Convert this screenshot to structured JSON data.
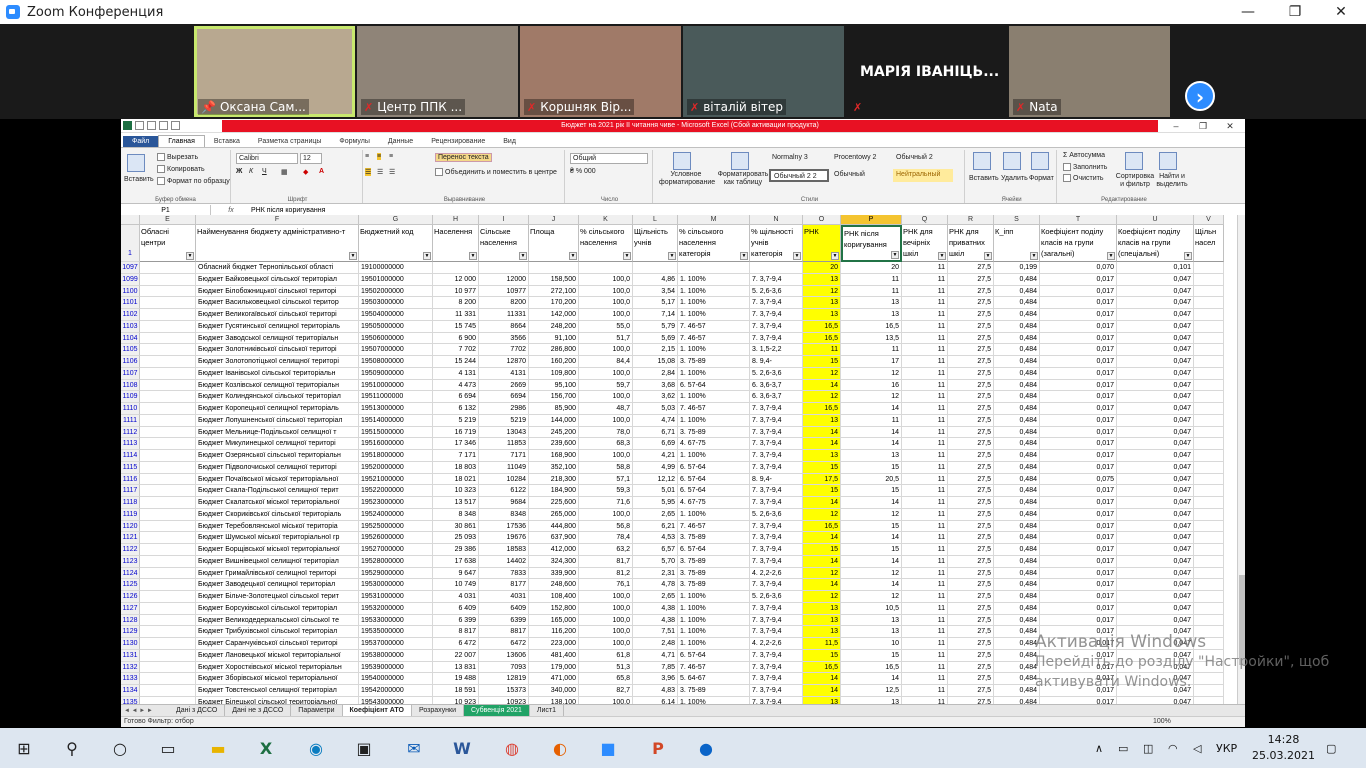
{
  "zoom": {
    "title": "Zoom Конференция",
    "participants": [
      {
        "name": "Оксана Сам...",
        "muted": false,
        "pinned": true,
        "speaking": true,
        "bg": "#b8a890"
      },
      {
        "name": "Центр ППК ...",
        "muted": true,
        "bg": "#8f8478"
      },
      {
        "name": "Коршняк Вір...",
        "muted": true,
        "bg": "#a07a68"
      },
      {
        "name": "віталій вітер",
        "muted": true,
        "bg": "#4a5a5a"
      },
      {
        "name": "МАРІЯ ІВАНІЦЬ...",
        "muted": true,
        "bg": "#1a1a1a",
        "name_only": true
      },
      {
        "name": "Nata",
        "muted": true,
        "bg": "#8a7f70"
      }
    ],
    "next_icon": "chevron-right-icon"
  },
  "excel": {
    "title": "Бюджет на 2021 рік II читання чиве - Microsoft Excel (Сбой активации продукта)",
    "tabs": [
      "Файл",
      "Главная",
      "Вставка",
      "Разметка страницы",
      "Формулы",
      "Данные",
      "Рецензирование",
      "Вид"
    ],
    "ribbon": {
      "clipboard": {
        "paste": "Вставить",
        "cut": "Вырезать",
        "copy": "Копировать",
        "format": "Формат по образцу",
        "label": "Буфер обмена"
      },
      "font": {
        "name": "Calibri",
        "size": "12",
        "label": "Шрифт"
      },
      "align": {
        "wrap": "Перенос текста",
        "merge": "Объединить и поместить в центре",
        "label": "Выравнивание"
      },
      "number": {
        "format": "Общий",
        "label": "Число"
      },
      "styles": {
        "cond": "Условное форматирование",
        "table": "Форматировать как таблицу",
        "s1": "Normalny 3",
        "s2": "Procentowy 2",
        "s3": "Обычный 2",
        "s4": "Обычный 2 2",
        "s5": "Обычный",
        "s6": "Нейтральный",
        "label": "Стили"
      },
      "cells": {
        "insert": "Вставить",
        "delete": "Удалить",
        "format": "Формат",
        "label": "Ячейки"
      },
      "edit": {
        "autosum": "Автосумма",
        "fill": "Заполнить",
        "clear": "Очистить",
        "sort": "Сортировка и фильтр",
        "find": "Найти и выделить",
        "label": "Редактирование"
      }
    },
    "namebox": "P1",
    "formula": "РНК після коригування",
    "columns": [
      "E",
      "F",
      "G",
      "H",
      "I",
      "J",
      "K",
      "L",
      "M",
      "N",
      "O",
      "P",
      "Q",
      "R",
      "S",
      "T",
      "U",
      "V"
    ],
    "selected_col": "P",
    "headers": [
      "Обласні центри",
      "Найменування бюджету адміністративно-т",
      "Бюджетний код",
      "Населення",
      "Сільське населення",
      "Площа",
      "% сільського населення",
      "Щільність учнів",
      "% сільського населення категорія",
      "% щільності учнів категорія",
      "РНК",
      "РНК після коригування",
      "РНК для вечірніх шкіл",
      "РНК для приватних шкіл",
      "К_іпп",
      "Коефіцієнт поділу класів на групи (загальні)",
      "Коефіцієнт поділу класів на групи (спеціальні)",
      "Щільн насел"
    ],
    "header_row": "1",
    "rows": [
      [
        "1097",
        "",
        "Обласний бюджет Тернопільської області",
        "19100000000",
        "",
        "",
        "",
        "",
        "",
        "",
        "",
        "20",
        "20",
        "11",
        "27,5",
        "0,199",
        "0,070",
        "0,101"
      ],
      [
        "1099",
        "",
        "Бюджет Байковецької сільської територіал",
        "19501000000",
        "12 000",
        "12000",
        "158,500",
        "100,0",
        "4,86",
        "1. 100%",
        "7. 3,7-9,4",
        "13",
        "11",
        "11",
        "27,5",
        "0,484",
        "0,017",
        "0,047"
      ],
      [
        "1100",
        "",
        "Бюджет Білобожницької сільської територі",
        "19502000000",
        "10 977",
        "10977",
        "272,100",
        "100,0",
        "3,54",
        "1. 100%",
        "5. 2,6-3,6",
        "12",
        "11",
        "11",
        "27,5",
        "0,484",
        "0,017",
        "0,047"
      ],
      [
        "1101",
        "",
        "Бюджет Васильковецької сільської територ",
        "19503000000",
        "8 200",
        "8200",
        "170,200",
        "100,0",
        "5,17",
        "1. 100%",
        "7. 3,7-9,4",
        "13",
        "13",
        "11",
        "27,5",
        "0,484",
        "0,017",
        "0,047"
      ],
      [
        "1102",
        "",
        "Бюджет Великогаївської сільської територі",
        "19504000000",
        "11 331",
        "11331",
        "142,000",
        "100,0",
        "7,14",
        "1. 100%",
        "7. 3,7-9,4",
        "13",
        "13",
        "11",
        "27,5",
        "0,484",
        "0,017",
        "0,047"
      ],
      [
        "1103",
        "",
        "Бюджет Гусятинської селищної територіаль",
        "19505000000",
        "15 745",
        "8664",
        "248,200",
        "55,0",
        "5,79",
        "7. 46-57",
        "7. 3,7-9,4",
        "16,5",
        "16,5",
        "11",
        "27,5",
        "0,484",
        "0,017",
        "0,047"
      ],
      [
        "1104",
        "",
        "Бюджет Заводської селищної територіальн",
        "19506000000",
        "6 900",
        "3566",
        "91,100",
        "51,7",
        "5,69",
        "7. 46-57",
        "7. 3,7-9,4",
        "16,5",
        "13,5",
        "11",
        "27,5",
        "0,484",
        "0,017",
        "0,047"
      ],
      [
        "1105",
        "",
        "Бюджет Золотниківської сільської територі",
        "19507000000",
        "7 702",
        "7702",
        "286,800",
        "100,0",
        "2,15",
        "1. 100%",
        "3. 1,5-2,2",
        "11",
        "11",
        "11",
        "27,5",
        "0,484",
        "0,017",
        "0,047"
      ],
      [
        "1106",
        "",
        "Бюджет Золотопотіцької селищної територі",
        "19508000000",
        "15 244",
        "12870",
        "160,200",
        "84,4",
        "15,08",
        "3. 75-89",
        "8. 9,4-",
        "15",
        "17",
        "11",
        "27,5",
        "0,484",
        "0,017",
        "0,047"
      ],
      [
        "1107",
        "",
        "Бюджет Іванівської сільської територіальн",
        "19509000000",
        "4 131",
        "4131",
        "109,800",
        "100,0",
        "2,84",
        "1. 100%",
        "5. 2,6-3,6",
        "12",
        "12",
        "11",
        "27,5",
        "0,484",
        "0,017",
        "0,047"
      ],
      [
        "1108",
        "",
        "Бюджет Козлівської селищної територіальн",
        "19510000000",
        "4 473",
        "2669",
        "95,100",
        "59,7",
        "3,68",
        "6. 57-64",
        "6. 3,6-3,7",
        "14",
        "16",
        "11",
        "27,5",
        "0,484",
        "0,017",
        "0,047"
      ],
      [
        "1109",
        "",
        "Бюджет Колиндянської сільської територіал",
        "19511000000",
        "6 694",
        "6694",
        "156,700",
        "100,0",
        "3,62",
        "1. 100%",
        "6. 3,6-3,7",
        "12",
        "12",
        "11",
        "27,5",
        "0,484",
        "0,017",
        "0,047"
      ],
      [
        "1110",
        "",
        "Бюджет Коропецької селищної територіаль",
        "19513000000",
        "6 132",
        "2986",
        "85,900",
        "48,7",
        "5,03",
        "7. 46-57",
        "7. 3,7-9,4",
        "16,5",
        "14",
        "11",
        "27,5",
        "0,484",
        "0,017",
        "0,047"
      ],
      [
        "1111",
        "",
        "Бюджет Лопушненської сільської територіал",
        "19514000000",
        "5 219",
        "5219",
        "144,000",
        "100,0",
        "4,74",
        "1. 100%",
        "7. 3,7-9,4",
        "13",
        "11",
        "11",
        "27,5",
        "0,484",
        "0,017",
        "0,047"
      ],
      [
        "1112",
        "",
        "Бюджет Мельнице-Подільської селищної т",
        "19515000000",
        "16 719",
        "13043",
        "245,200",
        "78,0",
        "6,71",
        "3. 75-89",
        "7. 3,7-9,4",
        "14",
        "14",
        "11",
        "27,5",
        "0,484",
        "0,017",
        "0,047"
      ],
      [
        "1113",
        "",
        "Бюджет Микулинецької селищної територі",
        "19516000000",
        "17 346",
        "11853",
        "239,600",
        "68,3",
        "6,69",
        "4. 67-75",
        "7. 3,7-9,4",
        "14",
        "14",
        "11",
        "27,5",
        "0,484",
        "0,017",
        "0,047"
      ],
      [
        "1114",
        "",
        "Бюджет Озерянської сільської територіальн",
        "19518000000",
        "7 171",
        "7171",
        "168,900",
        "100,0",
        "4,21",
        "1. 100%",
        "7. 3,7-9,4",
        "13",
        "13",
        "11",
        "27,5",
        "0,484",
        "0,017",
        "0,047"
      ],
      [
        "1115",
        "",
        "Бюджет Підволочиської селищної територі",
        "19520000000",
        "18 803",
        "11049",
        "352,100",
        "58,8",
        "4,99",
        "6. 57-64",
        "7. 3,7-9,4",
        "15",
        "15",
        "11",
        "27,5",
        "0,484",
        "0,017",
        "0,047"
      ],
      [
        "1116",
        "",
        "Бюджет Почаївської міської територіальної",
        "19521000000",
        "18 021",
        "10284",
        "218,300",
        "57,1",
        "12,12",
        "6. 57-64",
        "8. 9,4-",
        "17,5",
        "20,5",
        "11",
        "27,5",
        "0,484",
        "0,075",
        "0,047"
      ],
      [
        "1117",
        "",
        "Бюджет Скала-Подільської селищної терит",
        "19522000000",
        "10 323",
        "6122",
        "184,900",
        "59,3",
        "5,01",
        "6. 57-64",
        "7. 3,7-9,4",
        "15",
        "15",
        "11",
        "27,5",
        "0,484",
        "0,017",
        "0,047"
      ],
      [
        "1118",
        "",
        "Бюджет Скалатської міської територіальної",
        "19523000000",
        "13 517",
        "9684",
        "225,600",
        "71,6",
        "5,95",
        "4. 67-75",
        "7. 3,7-9,4",
        "14",
        "14",
        "11",
        "27,5",
        "0,484",
        "0,017",
        "0,047"
      ],
      [
        "1119",
        "",
        "Бюджет Скориківської сільської територіаль",
        "19524000000",
        "8 348",
        "8348",
        "265,000",
        "100,0",
        "2,65",
        "1. 100%",
        "5. 2,6-3,6",
        "12",
        "12",
        "11",
        "27,5",
        "0,484",
        "0,017",
        "0,047"
      ],
      [
        "1120",
        "",
        "Бюджет Теребовлянської міської територіа",
        "19525000000",
        "30 861",
        "17536",
        "444,800",
        "56,8",
        "6,21",
        "7. 46-57",
        "7. 3,7-9,4",
        "16,5",
        "15",
        "11",
        "27,5",
        "0,484",
        "0,017",
        "0,047"
      ],
      [
        "1121",
        "",
        "Бюджет Шумської міської територіальної гр",
        "19526000000",
        "25 093",
        "19676",
        "637,900",
        "78,4",
        "4,53",
        "3. 75-89",
        "7. 3,7-9,4",
        "14",
        "14",
        "11",
        "27,5",
        "0,484",
        "0,017",
        "0,047"
      ],
      [
        "1122",
        "",
        "Бюджет Борщівської міської територіальної",
        "19527000000",
        "29 386",
        "18583",
        "412,000",
        "63,2",
        "6,57",
        "6. 57-64",
        "7. 3,7-9,4",
        "15",
        "15",
        "11",
        "27,5",
        "0,484",
        "0,017",
        "0,047"
      ],
      [
        "1123",
        "",
        "Бюджет Вишнівецької селищної територіал",
        "19528000000",
        "17 638",
        "14402",
        "324,300",
        "81,7",
        "5,70",
        "3. 75-89",
        "7. 3,7-9,4",
        "14",
        "14",
        "11",
        "27,5",
        "0,484",
        "0,017",
        "0,047"
      ],
      [
        "1124",
        "",
        "Бюджет Гримайлівської селищної територі",
        "19529000000",
        "9 647",
        "7833",
        "339,900",
        "81,2",
        "2,31",
        "3. 75-89",
        "4. 2,2-2,6",
        "12",
        "12",
        "11",
        "27,5",
        "0,484",
        "0,017",
        "0,047"
      ],
      [
        "1125",
        "",
        "Бюджет Заводецької селищної територіал",
        "19530000000",
        "10 749",
        "8177",
        "248,600",
        "76,1",
        "4,78",
        "3. 75-89",
        "7. 3,7-9,4",
        "14",
        "14",
        "11",
        "27,5",
        "0,484",
        "0,017",
        "0,047"
      ],
      [
        "1126",
        "",
        "Бюджет Більче-Золотецької сільської терит",
        "19531000000",
        "4 031",
        "4031",
        "108,400",
        "100,0",
        "2,65",
        "1. 100%",
        "5. 2,6-3,6",
        "12",
        "12",
        "11",
        "27,5",
        "0,484",
        "0,017",
        "0,047"
      ],
      [
        "1127",
        "",
        "Бюджет Борсуківської сільської територіал",
        "19532000000",
        "6 409",
        "6409",
        "152,800",
        "100,0",
        "4,38",
        "1. 100%",
        "7. 3,7-9,4",
        "13",
        "10,5",
        "11",
        "27,5",
        "0,484",
        "0,017",
        "0,047"
      ],
      [
        "1128",
        "",
        "Бюджет Великодедеркальської сільської те",
        "19533000000",
        "6 399",
        "6399",
        "165,000",
        "100,0",
        "4,38",
        "1. 100%",
        "7. 3,7-9,4",
        "13",
        "13",
        "11",
        "27,5",
        "0,484",
        "0,017",
        "0,047"
      ],
      [
        "1129",
        "",
        "Бюджет Трибухівської сільської територіал",
        "19535000000",
        "8 817",
        "8817",
        "116,200",
        "100,0",
        "7,51",
        "1. 100%",
        "7. 3,7-9,4",
        "13",
        "13",
        "11",
        "27,5",
        "0,484",
        "0,017",
        "0,047"
      ],
      [
        "1130",
        "",
        "Бюджет Саранчуківської сільської територі",
        "19537000000",
        "6 472",
        "6472",
        "223,000",
        "100,0",
        "2,48",
        "1. 100%",
        "4. 2,2-2,6",
        "11,5",
        "10",
        "11",
        "27,5",
        "0,484",
        "0,017",
        "0,047"
      ],
      [
        "1131",
        "",
        "Бюджет Лановецької міської територіальної",
        "19538000000",
        "22 007",
        "13606",
        "481,400",
        "61,8",
        "4,71",
        "6. 57-64",
        "7. 3,7-9,4",
        "15",
        "15",
        "11",
        "27,5",
        "0,484",
        "0,017",
        "0,047"
      ],
      [
        "1132",
        "",
        "Бюджет Хоростківської міської територіальн",
        "19539000000",
        "13 831",
        "7093",
        "179,000",
        "51,3",
        "7,85",
        "7. 46-57",
        "7. 3,7-9,4",
        "16,5",
        "16,5",
        "11",
        "27,5",
        "0,484",
        "0,017",
        "0,047"
      ],
      [
        "1133",
        "",
        "Бюджет Зборівської міської територіальної",
        "19540000000",
        "19 488",
        "12819",
        "471,000",
        "65,8",
        "3,96",
        "5. 64-67",
        "7. 3,7-9,4",
        "14",
        "14",
        "11",
        "27,5",
        "0,484",
        "0,017",
        "0,047"
      ],
      [
        "1134",
        "",
        "Бюджет Товстенської селищної територіал",
        "19542000000",
        "18 591",
        "15373",
        "340,000",
        "82,7",
        "4,83",
        "3. 75-89",
        "7. 3,7-9,4",
        "14",
        "12,5",
        "11",
        "27,5",
        "0,484",
        "0,017",
        "0,047"
      ],
      [
        "1135",
        "",
        "Бюджет Білецької сільської територіальної",
        "19543000000",
        "10 923",
        "10923",
        "138,100",
        "100,0",
        "6,14",
        "1. 100%",
        "7. 3,7-9,4",
        "13",
        "13",
        "11",
        "27,5",
        "0,484",
        "0,017",
        "0,047"
      ]
    ],
    "sheet_tabs": [
      "Дані з ДССО",
      "Дані не з ДССО",
      "Параметри",
      "Коефіцієнт АТО",
      "Розрахунки",
      "Субвенція 2021",
      "Лист1"
    ],
    "active_tab": "Коефіцієнт АТО",
    "green_tab": "Субвенція 2021",
    "status": "Готово   Фильтр: отбор",
    "zoom": "100%"
  },
  "watermark": {
    "line1": "Активація Windows",
    "line2": "Перейдіть до розділу \"Настройки\", щоб",
    "line3": "активувати Windows."
  },
  "taskbar": {
    "apps": [
      "windows-start-icon",
      "search-icon",
      "cortana-icon",
      "task-view-icon",
      "file-explorer-icon",
      "excel-icon",
      "edge-icon",
      "store-icon",
      "mail-icon",
      "word-icon",
      "chrome-icon",
      "firefox-icon",
      "zoom-icon",
      "powerpoint-icon",
      "onedrive-icon"
    ],
    "lang": "УКР",
    "time": "14:28",
    "date": "25.03.2021"
  }
}
